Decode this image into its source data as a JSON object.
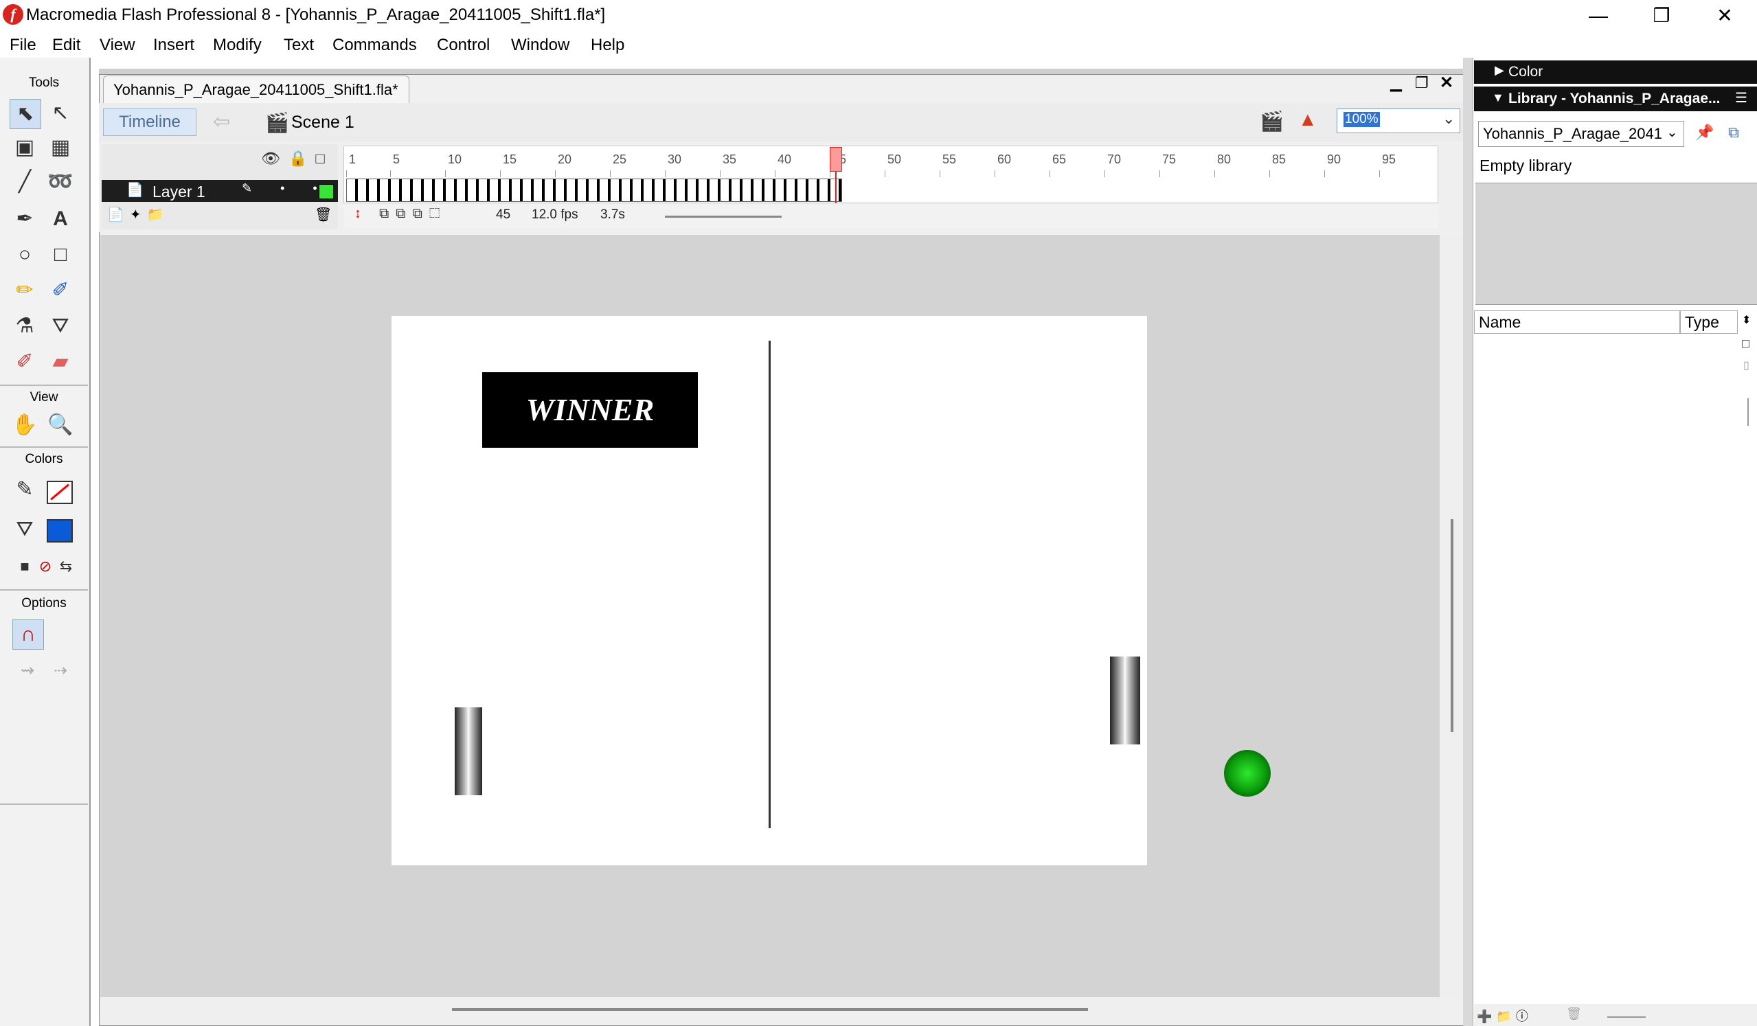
{
  "window": {
    "title": "Macromedia Flash Professional 8 - [Yohannis_P_Aragae_20411005_Shift1.fla*]",
    "icon_letter": "f",
    "minimize_glyph": "—",
    "maximize_glyph": "❐",
    "close_glyph": "✕"
  },
  "menu": [
    "File",
    "Edit",
    "View",
    "Insert",
    "Modify",
    "Text",
    "Commands",
    "Control",
    "Window",
    "Help"
  ],
  "tools": {
    "header": "Tools",
    "view_header": "View",
    "colors_header": "Colors",
    "options_header": "Options",
    "icons": [
      "arrow-icon",
      "subselect-icon",
      "free-transform-icon",
      "fill-transform-icon",
      "line-icon",
      "lasso-icon",
      "pen-icon",
      "text-icon",
      "oval-icon",
      "rectangle-icon",
      "pencil-icon",
      "brush-icon",
      "ink-bottle-icon",
      "paint-bucket-icon",
      "eyedropper-icon",
      "eraser-icon",
      "hand-icon",
      "zoom-icon",
      "stroke-color-icon",
      "fill-color-icon",
      "snap-magnet-icon"
    ],
    "fill_color": "#0a5bd8",
    "stroke_color": "#ff0000"
  },
  "document": {
    "tab_label": "Yohannis_P_Aragae_20411005_Shift1.fla*",
    "timeline_button": "Timeline",
    "scene_label": "Scene 1",
    "zoom": "100%"
  },
  "timeline": {
    "layer_name": "Layer 1",
    "current_frame": "45",
    "frame_rate": "12.0 fps",
    "elapsed": "3.7s",
    "ruler": [
      "1",
      "5",
      "10",
      "15",
      "20",
      "25",
      "30",
      "35",
      "40",
      "45",
      "50",
      "55",
      "60",
      "65",
      "70",
      "75",
      "80",
      "85",
      "90",
      "95"
    ],
    "playhead_frame": 45,
    "filled_frames": 45,
    "layer_color": "#38e438"
  },
  "stage": {
    "winner_text": "WINNER",
    "ball_color": "#0b9a0b"
  },
  "panels": {
    "color_title": "Color",
    "library_title": "Library - Yohannis_P_Aragae...",
    "library_select": "Yohannis_P_Aragae_2041",
    "empty_text": "Empty library",
    "col_name": "Name",
    "col_type": "Type"
  }
}
